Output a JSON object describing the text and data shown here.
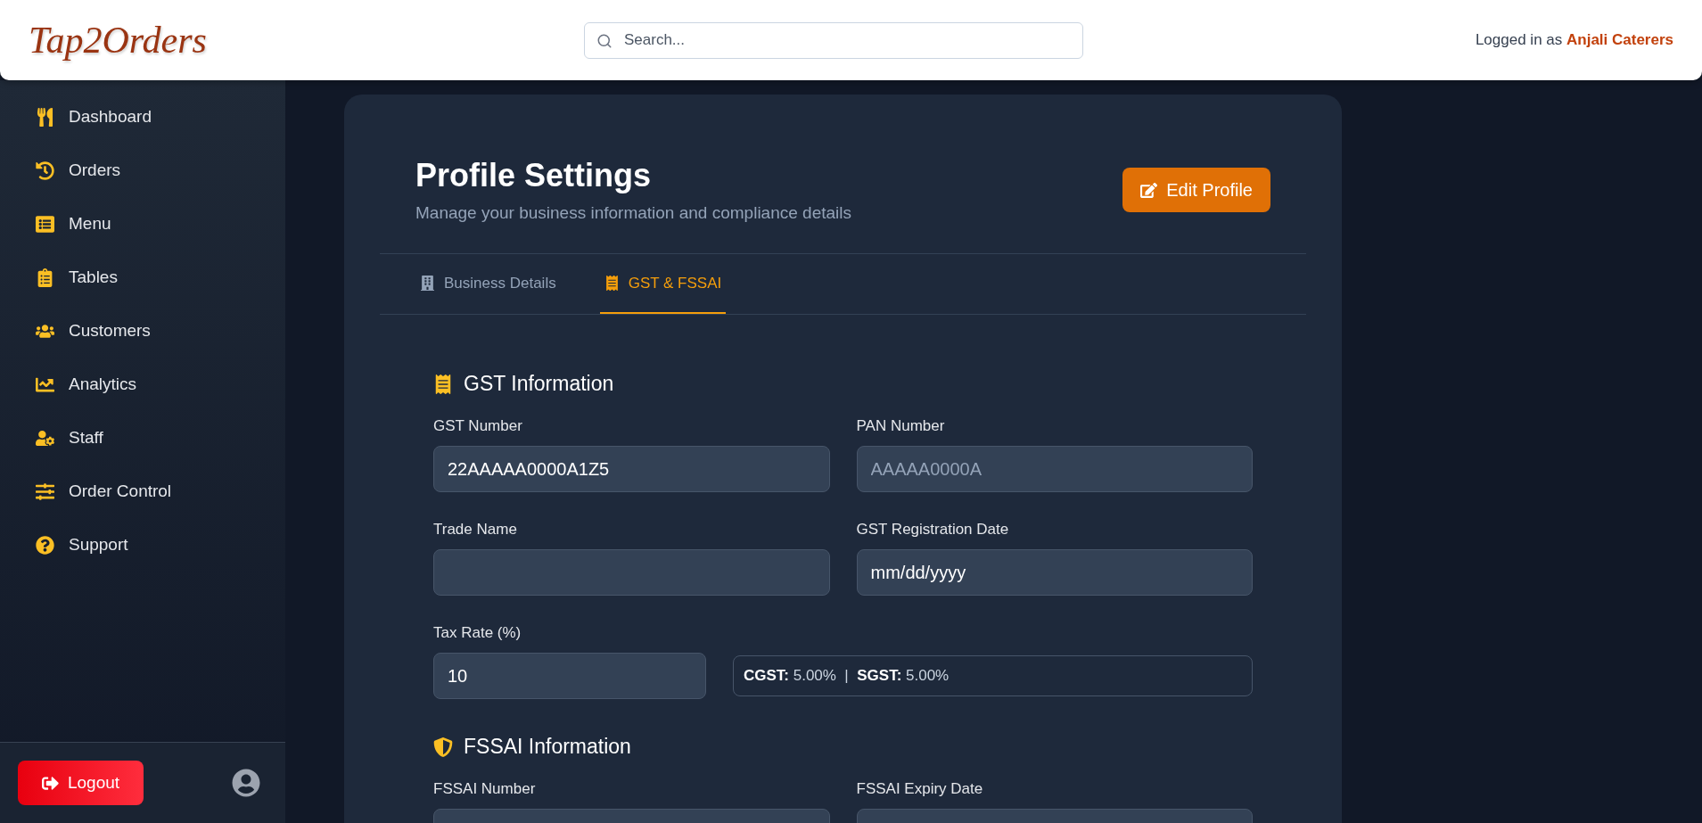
{
  "header": {
    "logo": "Tap2Orders",
    "search": {
      "placeholder": "Search..."
    },
    "user_text": "Logged in as **Anjali Caterers**"
  },
  "sidebar": {
    "items": [
      {
        "label": "Dashboard",
        "selected": false
      },
      {
        "label": "Orders",
        "selected": false
      },
      {
        "label": "Menu",
        "selected": false
      },
      {
        "label": "Tables",
        "selected": false
      },
      {
        "label": "Customers",
        "selected": false
      },
      {
        "label": "Analytics",
        "selected": false
      },
      {
        "label": "Staff",
        "selected": false
      },
      {
        "label": "Order Control",
        "selected": false
      },
      {
        "label": "Support",
        "selected": false
      }
    ],
    "logout": "Logout"
  },
  "card": {
    "title": "Profile Settings",
    "subtitle": "Manage your business information and compliance details",
    "edit_button": "Edit Profile",
    "tabs": [
      {
        "label": "Business Details",
        "selected": false
      },
      {
        "label": "GST & FSSAI",
        "selected": true
      }
    ],
    "sections": [
      {
        "title": "GST Information",
        "rows": [
          [
            {
              "label": "GST Number",
              "value": "22AAAAA0000A1Z5",
              "kind": "text"
            },
            {
              "label": "PAN Number",
              "placeholder": "AAAAA0000A",
              "kind": "text"
            }
          ],
          [
            {
              "label": "Trade Name",
              "kind": "text"
            },
            {
              "label": "GST Registration Date",
              "placeholder": "mm/dd/yyyy",
              "kind": "date"
            }
          ],
          [
            {
              "label": "Tax Rate (%)",
              "value": "10",
              "kind": "tax",
              "split": "**CGST:** 5.00%  |  **SGST:** 5.00%"
            }
          ]
        ]
      },
      {
        "title": "FSSAI Information",
        "rows": [
          [
            {
              "label": "FSSAI Number",
              "kind": "text"
            },
            {
              "label": "FSSAI Expiry Date",
              "kind": "text"
            }
          ]
        ]
      }
    ]
  }
}
